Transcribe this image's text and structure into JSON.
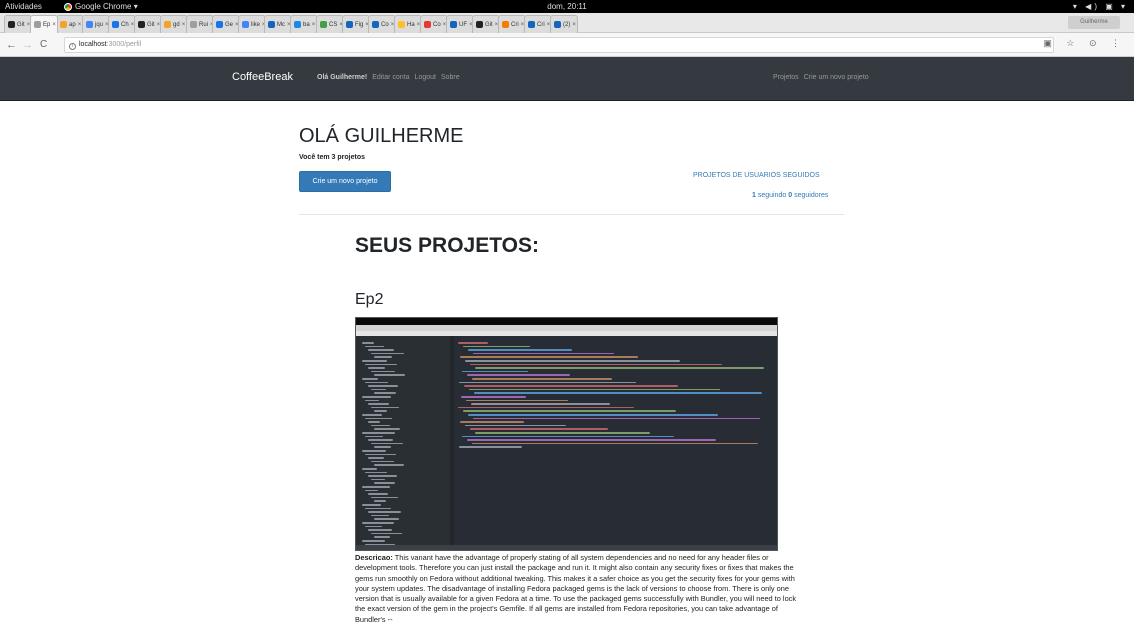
{
  "os_bar": {
    "activities": "Atividades",
    "app_name": "Google Chrome ▾",
    "clock": "dom, 20:11",
    "system_icons": "▾ ◀) ▣ ▾"
  },
  "browser": {
    "tabs": [
      {
        "label": "Git",
        "color": "#222222",
        "active": false
      },
      {
        "label": "Ep",
        "color": "#9e9e9e",
        "active": true
      },
      {
        "label": "ap",
        "color": "#f4a324",
        "active": false
      },
      {
        "label": "jqu",
        "color": "#4285f4",
        "active": false
      },
      {
        "label": "Ch",
        "color": "#1a73e8",
        "active": false
      },
      {
        "label": "Git",
        "color": "#222222",
        "active": false
      },
      {
        "label": "gd",
        "color": "#f4a324",
        "active": false
      },
      {
        "label": "Rui",
        "color": "#9e9e9e",
        "active": false
      },
      {
        "label": "Ge",
        "color": "#1a73e8",
        "active": false
      },
      {
        "label": "like",
        "color": "#4285f4",
        "active": false
      },
      {
        "label": "Mc",
        "color": "#1565c0",
        "active": false
      },
      {
        "label": "ba",
        "color": "#1e88e5",
        "active": false
      },
      {
        "label": "CS",
        "color": "#43a047",
        "active": false
      },
      {
        "label": "Fig",
        "color": "#1565c0",
        "active": false
      },
      {
        "label": "Co",
        "color": "#1565c0",
        "active": false
      },
      {
        "label": "Ha",
        "color": "#fbc02d",
        "active": false
      },
      {
        "label": "Co",
        "color": "#e53935",
        "active": false
      },
      {
        "label": "UF",
        "color": "#1565c0",
        "active": false
      },
      {
        "label": "Git",
        "color": "#222222",
        "active": false
      },
      {
        "label": "Cri",
        "color": "#f57c00",
        "active": false
      },
      {
        "label": "Cri",
        "color": "#1565c0",
        "active": false
      },
      {
        "label": "(2)",
        "color": "#1565c0",
        "active": false
      }
    ],
    "profile_label": "Guilherme",
    "url_host": "localhost",
    "url_path": ":3000/perfil",
    "omnibox_right_icons": "▣ ☆ ⊙ ⋮"
  },
  "navbar": {
    "brand": "CoffeeBreak",
    "greeting": "Olá Guilherme!",
    "edit_account": "Editar conta",
    "logout": "Logout",
    "about": "Sobre",
    "projects": "Projetos",
    "new_project": "Crie um novo projeto"
  },
  "profile": {
    "title": "OLÁ GUILHERME",
    "project_count": "Você tem 3 projetos",
    "new_project_button": "Crie um novo projeto",
    "followed_projects_link": "PROJETOS DE USUARIOS SEGUIDOS",
    "following_count": "1",
    "following_label": "seguindo",
    "followers_count": "0",
    "followers_label": "seguidores"
  },
  "projects_section": {
    "title": "SEUS PROJETOS:",
    "project": {
      "name": "Ep2",
      "description_label": "Descricao:",
      "description": "This vanant have the advantage of properly stating of all system dependencies and no need for any header files or development tools. Therefore you can just install the package and run it. It might also contain any security fixes or fixes that makes the gems run smoothly on Fedora without additional tweaking. This makes it a safer choice as you get the security fixes for your gems with your system updates. The disadvantage of installing Fedora packaged gems is the lack of versions to choose from. There is only one version that is usually available for a given Fedora at a time. To use the packaged gems successfully with Bundler, you will need to lock the exact version of the gem in the project's Gemfile. If all gems are installed from Fedora repositories, you can take advantage of Bundler's --"
    }
  }
}
